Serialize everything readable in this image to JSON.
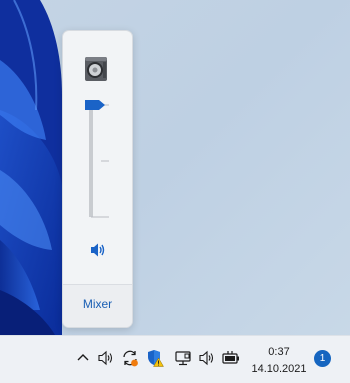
{
  "volume_flyout": {
    "device_icon": "speaker-device-icon",
    "volume_level": 1.0,
    "mute_icon": "speaker-icon",
    "mixer_label": "Mixer"
  },
  "taskbar": {
    "tray_icons": [
      "chevron-up-icon",
      "speaker-icon",
      "sync-alert-icon",
      "shield-warning-icon",
      "network-icon",
      "speaker-icon",
      "battery-icon"
    ],
    "clock": {
      "time": "0:37",
      "date": "14.10.2021"
    },
    "notification_count": "1"
  },
  "colors": {
    "accent": "#1a63c7",
    "taskbar": "#eef1f5",
    "flyout": "#f2f4f6"
  }
}
